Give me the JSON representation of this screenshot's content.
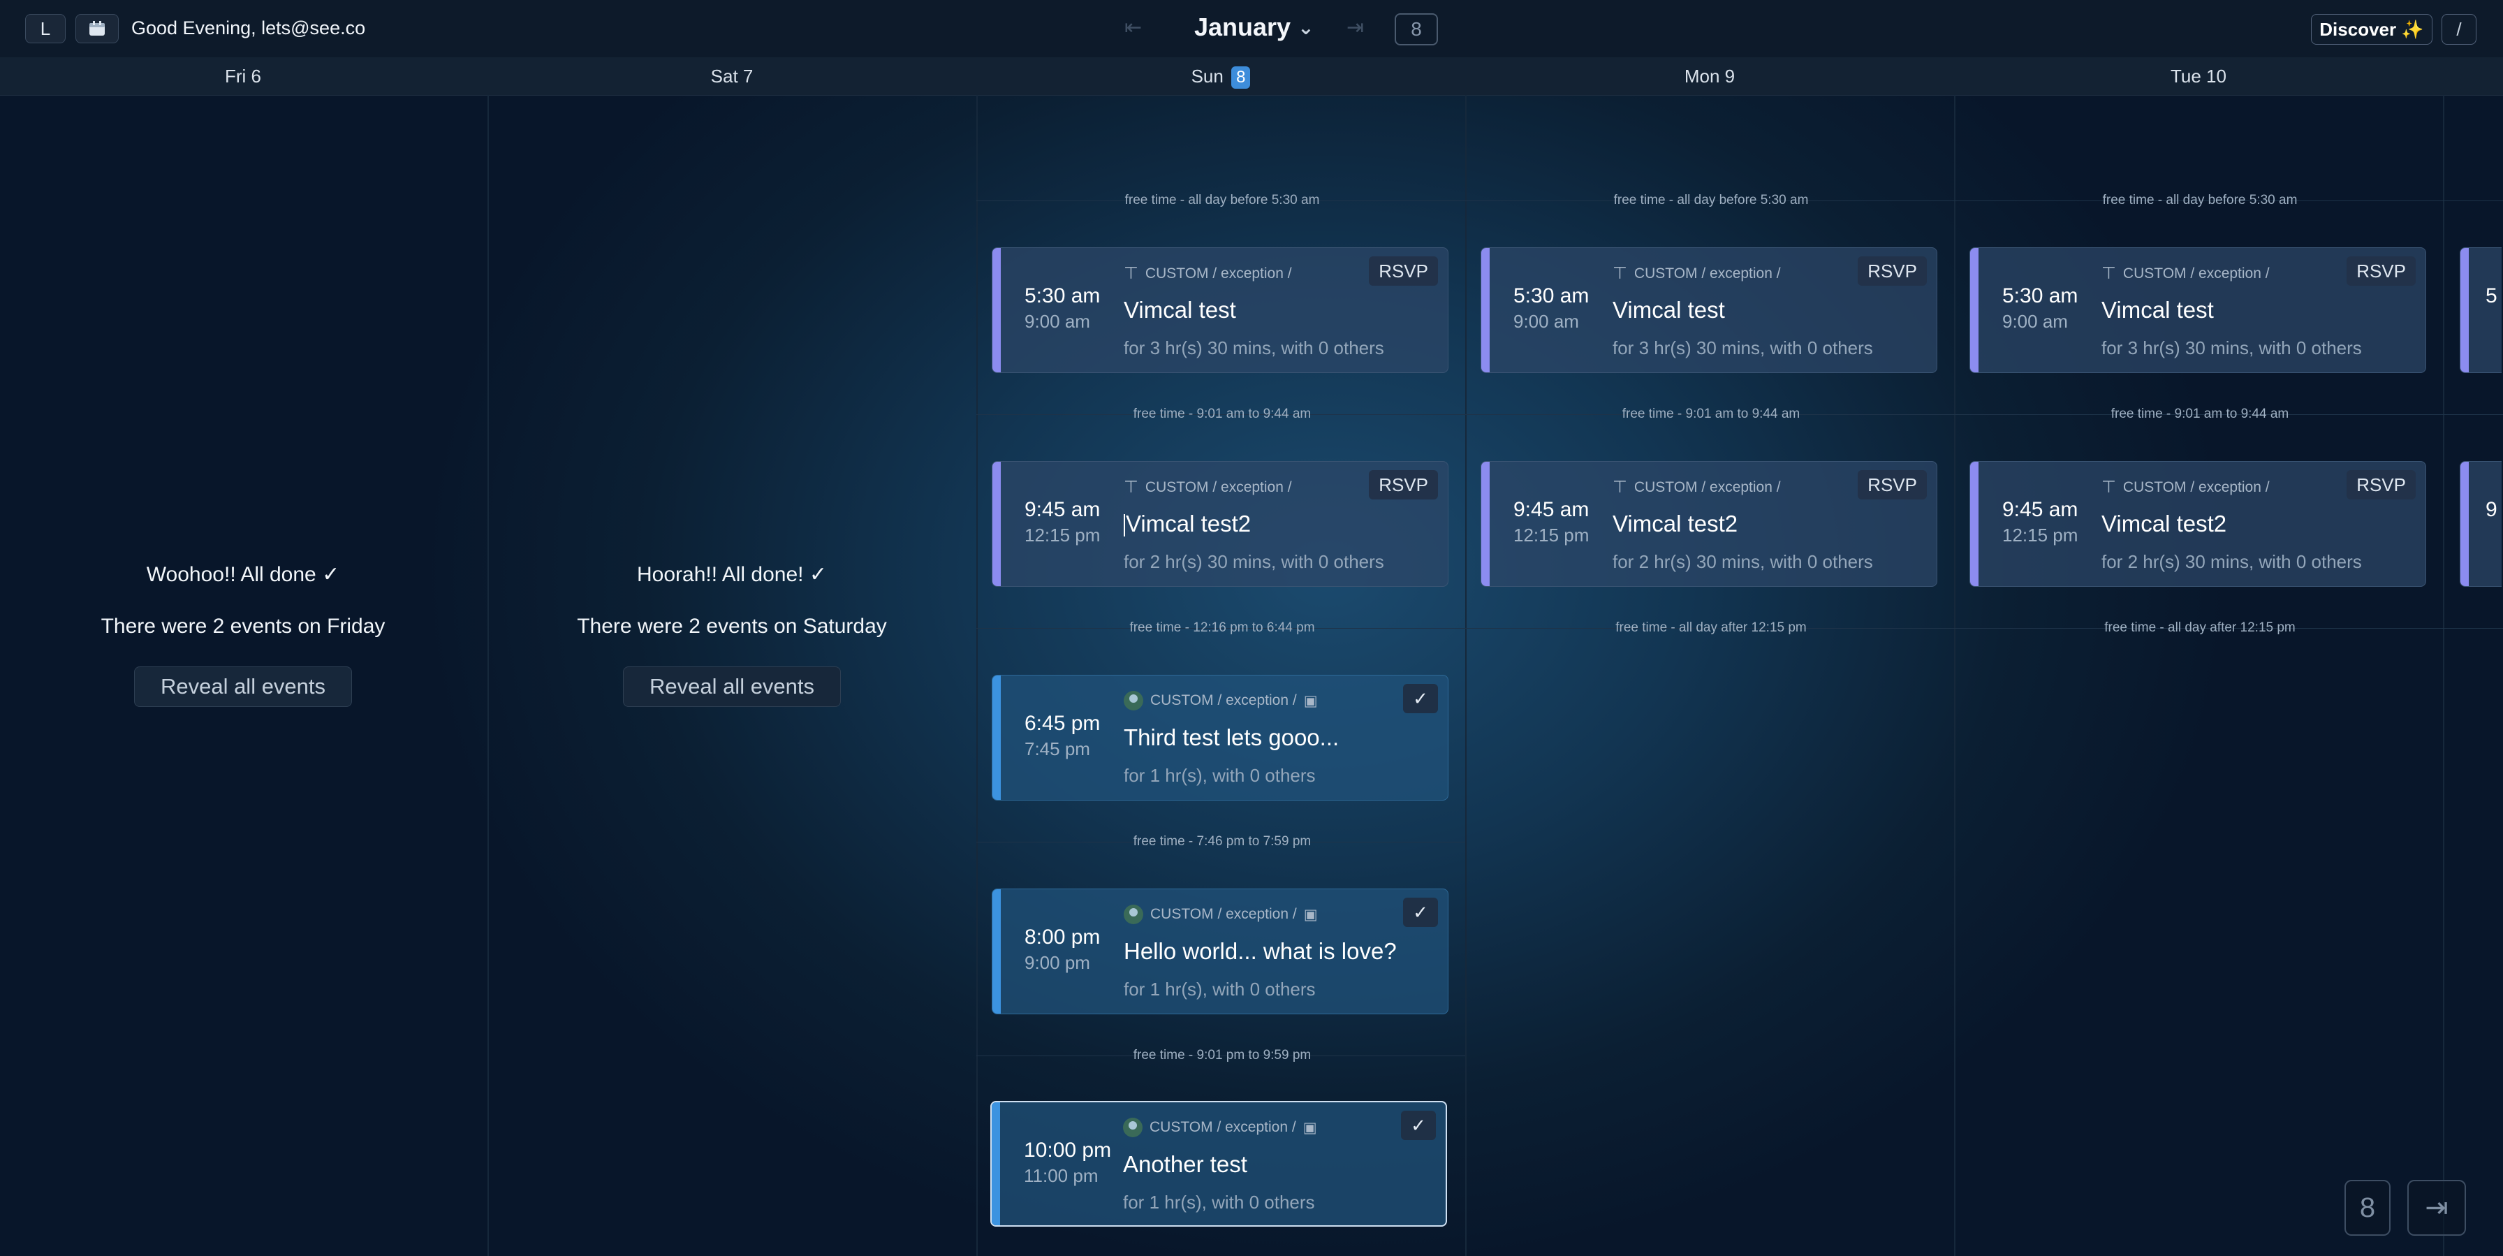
{
  "header": {
    "left_button_label": "L",
    "calendar_icon": "calendar-icon",
    "greeting": "Good Evening, lets@see.co",
    "prev_arrow": "⇤",
    "month": "January",
    "month_chevron": "⌄",
    "next_arrow": "⇥",
    "today_number": "8",
    "discover_label": "Discover ✨",
    "slash_label": "/"
  },
  "days": [
    {
      "label": "Fri 6"
    },
    {
      "label": "Sat 7"
    },
    {
      "label": "Sun",
      "badge": "8"
    },
    {
      "label": "Mon 9"
    },
    {
      "label": "Tue 10"
    }
  ],
  "done_panels": [
    {
      "headline": "Woohoo!! All done ✓",
      "summary": "There were 2 events on Friday",
      "button": "Reveal all events"
    },
    {
      "headline": "Hoorah!! All done! ✓",
      "summary": "There were 2 events on Saturday",
      "button": "Reveal all events"
    }
  ],
  "free_time": {
    "sun": [
      "free time - all day before 5:30 am",
      "free time - 9:01 am to 9:44 am",
      "free time - 12:16 pm to 6:44 pm",
      "free time - 7:46 pm to 7:59 pm",
      "free time - 9:01 pm to 9:59 pm"
    ],
    "mon": [
      "free time - all day before 5:30 am",
      "free time - 9:01 am to 9:44 am",
      "free time - all day after 12:15 pm"
    ],
    "tue": [
      "free time - all day before 5:30 am",
      "free time - 9:01 am to 9:44 am",
      "free time - all day after 12:15 pm"
    ]
  },
  "events": {
    "calendar_path": "CUSTOM / exception /",
    "rsvp_label": "RSVP",
    "check_label": "✓",
    "vimcal1": {
      "start": "5:30 am",
      "end": "9:00 am",
      "title": "Vimcal test",
      "duration": "for 3 hr(s) 30 mins, with 0 others"
    },
    "vimcal2": {
      "start": "9:45 am",
      "end": "12:15 pm",
      "title": "Vimcal test2",
      "duration": "for 2 hr(s) 30 mins, with 0 others"
    },
    "third": {
      "start": "6:45 pm",
      "end": "7:45 pm",
      "title": "Third test lets gooo...",
      "duration": "for 1 hr(s), with 0 others"
    },
    "hello": {
      "start": "8:00 pm",
      "end": "9:00 pm",
      "title": "Hello world... what is love?",
      "duration": "for 1 hr(s), with 0 others"
    },
    "another": {
      "start": "10:00 pm",
      "end": "11:00 pm",
      "title": "Another test",
      "duration": "for 1 hr(s), with 0 others"
    }
  },
  "peek": {
    "start1": "5",
    "start2": "9"
  },
  "footer": {
    "today_number": "8",
    "collapse_icon": "⇥"
  },
  "colors": {
    "accent": "#3d8ddb",
    "rsvp_bar": "#8c8cf0",
    "confirmed_bar": "#3c93e0"
  }
}
